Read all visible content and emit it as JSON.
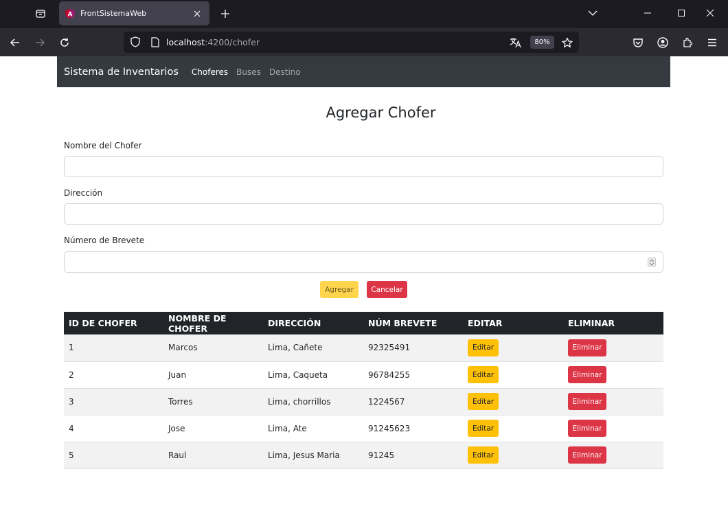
{
  "browser": {
    "tab_title": "FrontSistemaWeb",
    "url_host": "localhost",
    "url_path": ":4200/chofer",
    "zoom": "80%"
  },
  "navbar": {
    "brand": "Sistema de Inventarios",
    "links": [
      "Choferes",
      "Buses",
      "Destino"
    ]
  },
  "form": {
    "title": "Agregar Chofer",
    "fields": [
      {
        "label": "Nombre del Chofer",
        "value": ""
      },
      {
        "label": "Dirección",
        "value": ""
      },
      {
        "label": "Número de Brevete",
        "value": ""
      }
    ],
    "submit_label": "Agregar",
    "cancel_label": "Cancelar"
  },
  "table": {
    "headers": [
      "ID DE CHOFER",
      "NOMBRE DE CHOFER",
      "DIRECCIÓN",
      "NÚM BREVETE",
      "EDITAR",
      "ELIMINAR"
    ],
    "rows": [
      {
        "id": "1",
        "name": "Marcos",
        "address": "Lima, Cañete",
        "license": "92325491"
      },
      {
        "id": "2",
        "name": "Juan",
        "address": "Lima, Caqueta",
        "license": "96784255"
      },
      {
        "id": "3",
        "name": "Torres",
        "address": "Lima, chorrillos",
        "license": "1224567"
      },
      {
        "id": "4",
        "name": "Jose",
        "address": "Lima, Ate",
        "license": "91245623"
      },
      {
        "id": "5",
        "name": "Raul",
        "address": "Lima, Jesus Maria",
        "license": "91245"
      }
    ],
    "edit_label": "Editar",
    "delete_label": "Eliminar"
  },
  "colors": {
    "navbar_bg": "#343a40",
    "table_header_bg": "#212529",
    "warning": "#ffc107",
    "danger": "#dc3545"
  }
}
